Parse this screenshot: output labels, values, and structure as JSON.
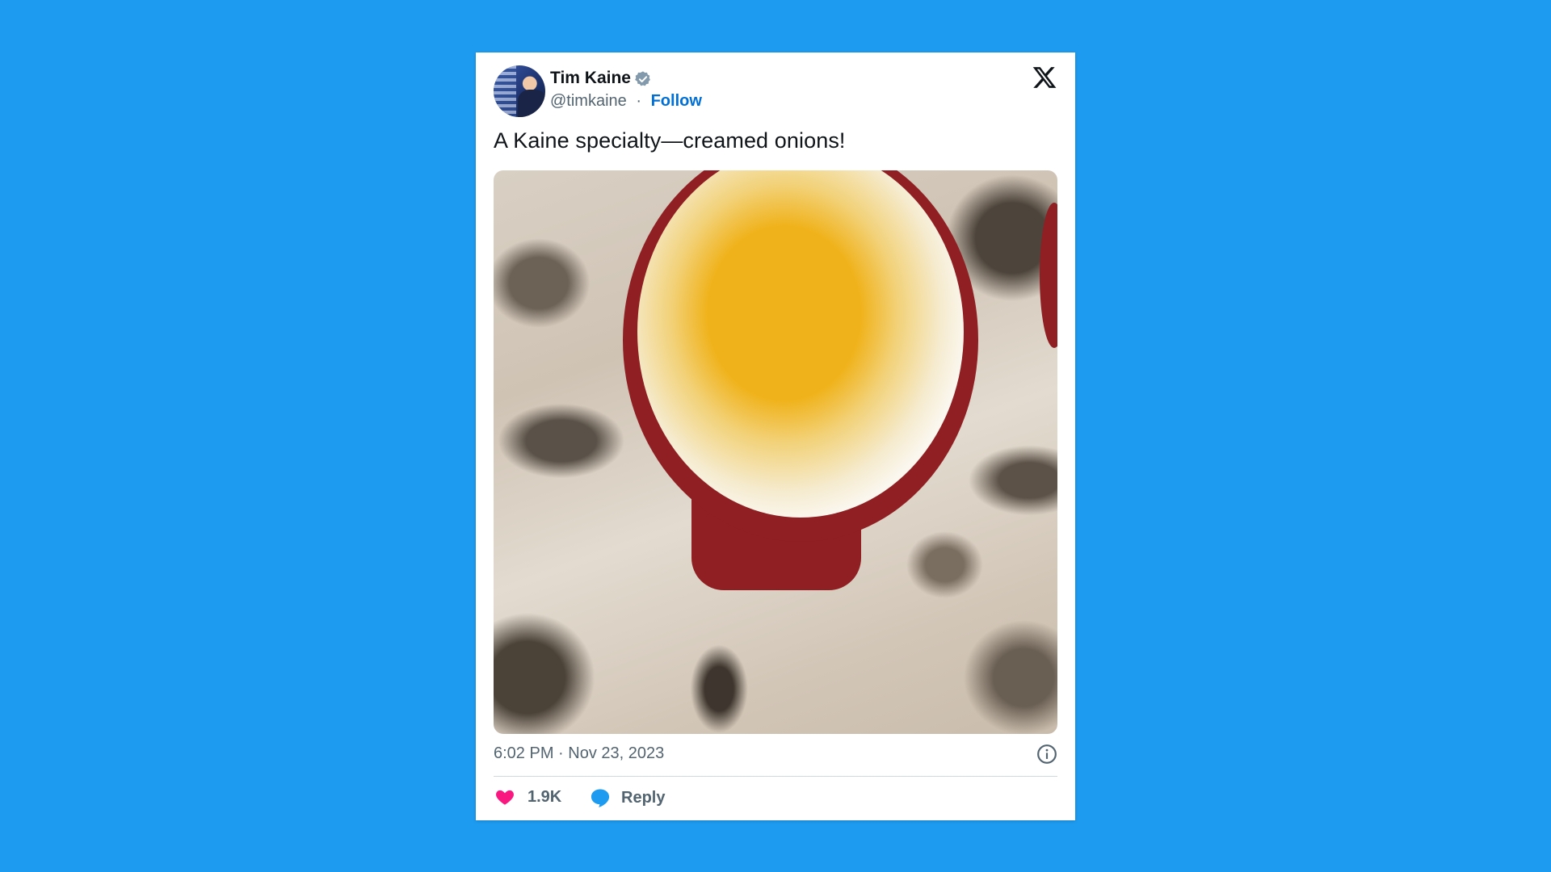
{
  "tweet": {
    "author_name": "Tim Kaine",
    "handle": "@timkaine",
    "separator": "·",
    "follow_label": "Follow",
    "text": "A Kaine specialty—creamed onions!",
    "timestamp": "6:02 PM · Nov 23, 2023",
    "likes": "1.9K",
    "reply_label": "Reply"
  },
  "icons": {
    "verified": "verified-badge-icon",
    "platform": "x-logo-icon",
    "info": "info-icon",
    "like": "heart-icon",
    "reply": "speech-bubble-icon"
  },
  "colors": {
    "background": "#1d9bf0",
    "follow": "#006fd6",
    "heart": "#f91880",
    "reply_bubble": "#1d9bf0",
    "muted_text": "#536471"
  }
}
